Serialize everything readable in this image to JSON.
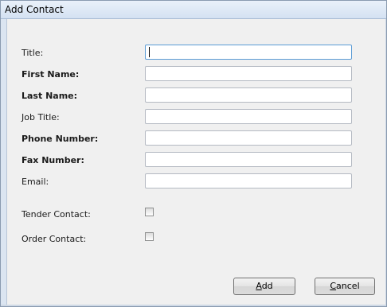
{
  "window": {
    "title": "Add Contact"
  },
  "form": {
    "fields": [
      {
        "label": "Title:",
        "value": ""
      },
      {
        "label": "First Name:",
        "value": ""
      },
      {
        "label": "Last Name:",
        "value": ""
      },
      {
        "label": "Job Title:",
        "value": ""
      },
      {
        "label": "Phone Number:",
        "value": ""
      },
      {
        "label": "Fax Number:",
        "value": ""
      },
      {
        "label": "Email:",
        "value": ""
      }
    ],
    "checkboxes": [
      {
        "label": "Tender Contact:",
        "checked": false
      },
      {
        "label": "Order Contact:",
        "checked": false
      }
    ]
  },
  "buttons": {
    "add_mnemonic": "A",
    "add_rest": "dd",
    "cancel_mnemonic": "C",
    "cancel_rest": "ancel"
  }
}
